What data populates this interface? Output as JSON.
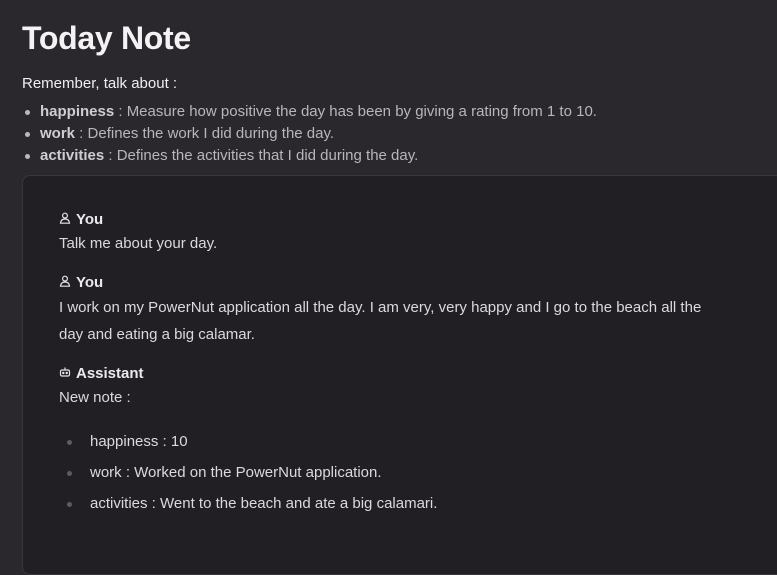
{
  "page": {
    "title": "Today Note",
    "remember_label": "Remember, talk about :"
  },
  "rules": [
    {
      "term": "happiness",
      "desc": " : Measure how positive the day has been by giving a rating from 1 to 10."
    },
    {
      "term": "work",
      "desc": " : Defines the work I did during the day."
    },
    {
      "term": "activities",
      "desc": " : Defines the activities that I did during the day."
    }
  ],
  "chat": {
    "messages": [
      {
        "role_icon": "user-icon",
        "role": "You",
        "text": "Talk me about your day."
      },
      {
        "role_icon": "user-icon",
        "role": "You",
        "text": "I work on my PowerNut application all the day. I am very, very happy and I go to the beach all the day and eating a big calamar."
      },
      {
        "role_icon": "robot-icon",
        "role": "Assistant",
        "text": "New note :"
      }
    ],
    "note_items": [
      "happiness : 10",
      "work : Worked on the PowerNut application.",
      "activities : Went to the beach and ate a big calamari."
    ]
  },
  "colors": {
    "background": "#2b282d",
    "panel": "#221f24",
    "text": "#e6e3e8",
    "muted": "#b9b5bc"
  }
}
